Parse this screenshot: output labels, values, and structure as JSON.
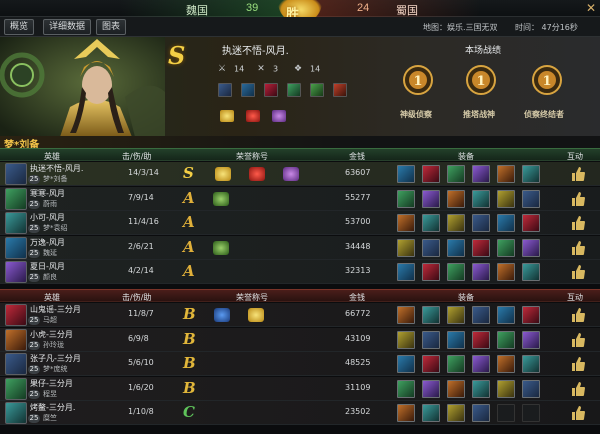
{
  "score": {
    "wei_name": "魏国",
    "wei_score": "39",
    "shu_name": "蜀国",
    "shu_score": "24",
    "emblem": "胜"
  },
  "tabs": [
    {
      "label": "概览"
    },
    {
      "label": "详细数据"
    },
    {
      "label": "图表"
    }
  ],
  "info": {
    "map": "地图：娱乐.三国无双",
    "time": "时间：  47分16秒"
  },
  "hero_panel": {
    "rank": "S",
    "title": "执迷不悟-风月.",
    "kills": "14",
    "deaths": "3",
    "assists": "14",
    "record_title": "本场战绩",
    "medals": [
      {
        "label": "神级侦察"
      },
      {
        "label": "推塔战神"
      },
      {
        "label": "侦察终结者"
      }
    ],
    "player_name": "梦*刘备"
  },
  "headers": {
    "hero": "英雄",
    "kda": "击/伤/助",
    "honor": "荣誉称号",
    "money": "金钱",
    "equip": "装备",
    "interact": "互动"
  },
  "colors": {
    "rank_s": "#f4cf45",
    "rank_a": "#e0b03a",
    "rank_b": "#e2b73a",
    "rank_c": "#5fc35a",
    "wei_header": "#23402a",
    "shu_header": "#4a1e1a"
  },
  "wei_rows": [
    {
      "player": "执迷不悟-风月.",
      "level": "25",
      "hero": "梦*刘备",
      "kda": "14/3/14",
      "rank": "S",
      "money": "63607"
    },
    {
      "player": "寒寒-风月",
      "level": "25",
      "hero": "蔚雨",
      "kda": "7/9/14",
      "rank": "A",
      "money": "55277"
    },
    {
      "player": "小可-风月",
      "level": "25",
      "hero": "梦*袁绍",
      "kda": "11/4/16",
      "rank": "A",
      "money": "53700"
    },
    {
      "player": "万逸-风月",
      "level": "25",
      "hero": "魏延",
      "kda": "2/6/21",
      "rank": "A",
      "money": "34448"
    },
    {
      "player": "夏日-风月",
      "level": "25",
      "hero": "颜良",
      "kda": "4/2/14",
      "rank": "A",
      "money": "32313"
    }
  ],
  "shu_rows": [
    {
      "player": "山鬼谣-三分月",
      "level": "25",
      "hero": "马超",
      "kda": "11/8/7",
      "rank": "B",
      "money": "66772"
    },
    {
      "player": "小虎-三分月",
      "level": "25",
      "hero": "孙玲珑",
      "kda": "6/9/8",
      "rank": "B",
      "money": "43109"
    },
    {
      "player": "张子凡-三分月",
      "level": "25",
      "hero": "梦*庞统",
      "kda": "5/6/10",
      "rank": "B",
      "money": "48525"
    },
    {
      "player": "果仔-三分月",
      "level": "25",
      "hero": "程昱",
      "kda": "1/6/20",
      "rank": "B",
      "money": "31109"
    },
    {
      "player": "烤鳌-三分月.",
      "level": "25",
      "hero": "糜竺",
      "kda": "1/10/8",
      "rank": "C",
      "money": "23502"
    }
  ]
}
